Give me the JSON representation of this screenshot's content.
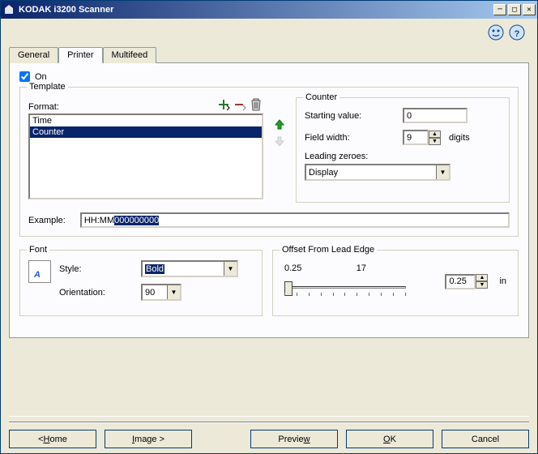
{
  "window": {
    "title": "KODAK i3200 Scanner"
  },
  "tabs": {
    "general": "General",
    "printer": "Printer",
    "multifeed": "Multifeed",
    "active": "Printer"
  },
  "printer": {
    "on_label": "On",
    "on": true,
    "template": {
      "title": "Template",
      "format_label": "Format:",
      "items": [
        "Time",
        "Counter"
      ],
      "selected_index": 1,
      "example_label": "Example:",
      "example_prefix": "HH:MM",
      "example_suffix": "000000000"
    },
    "counter": {
      "title": "Counter",
      "starting_label": "Starting value:",
      "starting_value": "0",
      "fieldwidth_label": "Field width:",
      "fieldwidth_value": "9",
      "fieldwidth_unit": "digits",
      "leading_label": "Leading zeroes:",
      "leading_value": "Display"
    },
    "font": {
      "title": "Font",
      "style_label": "Style:",
      "style_value": "Bold",
      "orientation_label": "Orientation:",
      "orientation_value": "90"
    },
    "offset": {
      "title": "Offset From Lead Edge",
      "min": "0.25",
      "max": "17",
      "value": "0.25",
      "unit": "in"
    }
  },
  "footer": {
    "home": "Home",
    "image": "Image",
    "preview": "Preview",
    "ok": "OK",
    "cancel": "Cancel"
  },
  "icons": {
    "add": "add-icon",
    "remove": "remove-icon",
    "delete": "trash-icon",
    "up": "arrow-up-icon",
    "down": "arrow-down-icon"
  }
}
